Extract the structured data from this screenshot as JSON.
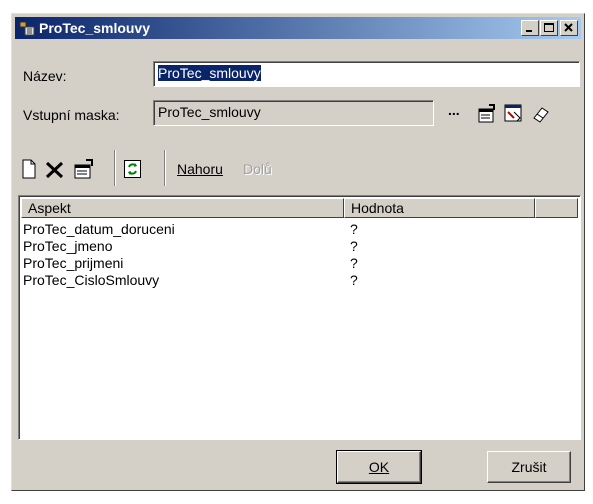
{
  "window": {
    "title": "ProTec_smlouvy"
  },
  "form": {
    "name_label": "Název:",
    "name_value": "ProTec_smlouvy",
    "mask_label": "Vstupní maska:",
    "mask_value": "ProTec_smlouvy",
    "ellipsis": "..."
  },
  "toolbar": {
    "up_label": "Nahoru",
    "down_label": "Dolů"
  },
  "table": {
    "columns": [
      "Aspekt",
      "Hodnota"
    ],
    "rows": [
      {
        "aspekt": "ProTec_datum_doruceni",
        "hodnota": "?"
      },
      {
        "aspekt": "ProTec_jmeno",
        "hodnota": "?"
      },
      {
        "aspekt": "ProTec_prijmeni",
        "hodnota": "?"
      },
      {
        "aspekt": "ProTec_CisloSmlouvy",
        "hodnota": "?"
      }
    ]
  },
  "buttons": {
    "ok": "OK",
    "cancel": "Zrušit"
  }
}
